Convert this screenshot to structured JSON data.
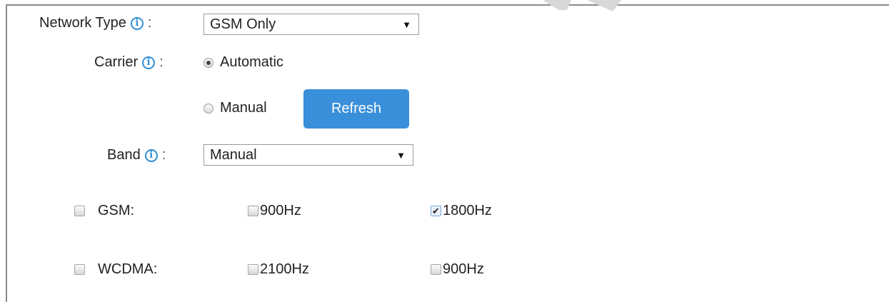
{
  "form": {
    "network_type": {
      "label": "Network Type",
      "colon": ":",
      "value": "GSM Only"
    },
    "carrier": {
      "label": "Carrier",
      "colon": ":",
      "options": [
        {
          "label": "Automatic",
          "selected": true
        },
        {
          "label": "Manual",
          "selected": false
        }
      ],
      "refresh_label": "Refresh"
    },
    "band": {
      "label": "Band",
      "colon": ":",
      "value": "Manual"
    },
    "gsm": {
      "label": "GSM:",
      "checked": false,
      "freqs": [
        {
          "label": "900Hz",
          "checked": false
        },
        {
          "label": "1800Hz",
          "checked": true
        }
      ]
    },
    "wcdma": {
      "label": "WCDMA:",
      "checked": false,
      "freqs": [
        {
          "label": "2100Hz",
          "checked": false
        },
        {
          "label": "900Hz",
          "checked": false
        }
      ]
    }
  },
  "icons": {
    "info": "info-icon",
    "dropdown": "caret-down-icon",
    "checkmark": "checkmark-icon"
  },
  "colors": {
    "accent": "#3a8fda",
    "info": "#2f8fd6",
    "frame": "#8a8a8a"
  }
}
